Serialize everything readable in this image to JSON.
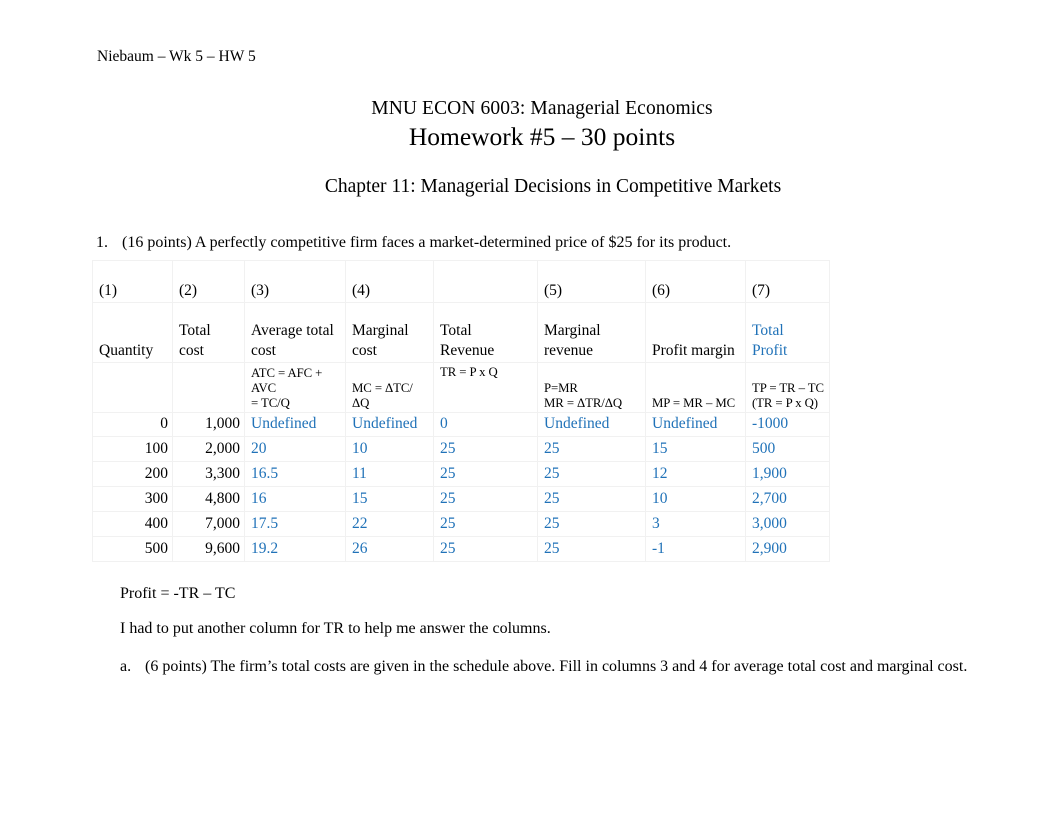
{
  "document": {
    "running_head": "Niebaum – Wk 5 – HW 5",
    "title_line_1": "MNU ECON 6003: Managerial Economics",
    "title_line_2": "Homework #5 – 30 points",
    "chapter_line": "Chapter 11: Managerial Decisions in Competitive Markets",
    "accent_color": "#2072B8"
  },
  "question1": {
    "marker": "1.",
    "text": "(16 points) A perfectly competitive firm faces a market-determined  price of $25 for its product."
  },
  "table": {
    "column_numbers": [
      "(1)",
      "(2)",
      "(3)",
      "(4)",
      "",
      "(5)",
      "(6)",
      "(7)"
    ],
    "column_labels": [
      "Quantity",
      "Total cost",
      "Average total cost",
      "Marginal cost",
      "Total Revenue",
      "Marginal revenue",
      "Profit margin",
      "Total Profit"
    ],
    "column_formulas": [
      "",
      "",
      "ATC = AFC + AVC = TC/Q",
      "MC = ΔTC/ΔQ",
      "TR = P x Q",
      "P=MR MR = ΔTR/ΔQ",
      "MP = MR – MC",
      "TP = TR – TC (TR = P x Q)"
    ],
    "formula_cells": {
      "atc_line1": "ATC = AFC + AVC",
      "atc_line2": "= TC/Q",
      "mc": "MC = ΔTC/ΔQ",
      "tr": "TR = P x Q",
      "mr_line1": "P=MR",
      "mr_line2": "MR = ΔTR/ΔQ",
      "mp": "MP = MR – MC",
      "tp_line1": "TP = TR – TC",
      "tp_line2": "(TR = P x Q)"
    },
    "label_cells": {
      "quantity": "Quantity",
      "total_cost_l1": "Total",
      "total_cost_l2": "cost",
      "atc_l1": "Average total",
      "atc_l2": "cost",
      "mc_l1": "Marginal",
      "mc_l2": "cost",
      "tr_l1": "Total",
      "tr_l2": "Revenue",
      "mr_l1": "Marginal",
      "mr_l2": "revenue",
      "mp": "Profit margin",
      "tp_l1": "Total",
      "tp_l2": "Profit"
    },
    "rows": [
      {
        "quantity": "0",
        "total_cost": "1,000",
        "atc": "Undefined",
        "mc": "Undefined",
        "tr": "0",
        "mr": "Undefined",
        "mp": "Undefined",
        "tp": "-1000"
      },
      {
        "quantity": "100",
        "total_cost": "2,000",
        "atc": "20",
        "mc": "10",
        "tr": "25",
        "mr": "25",
        "mp": "15",
        "tp": "500"
      },
      {
        "quantity": "200",
        "total_cost": "3,300",
        "atc": "16.5",
        "mc": "11",
        "tr": "25",
        "mr": "25",
        "mp": "12",
        "tp": "1,900"
      },
      {
        "quantity": "300",
        "total_cost": "4,800",
        "atc": "16",
        "mc": "15",
        "tr": "25",
        "mr": "25",
        "mp": "10",
        "tp": "2,700"
      },
      {
        "quantity": "400",
        "total_cost": "7,000",
        "atc": "17.5",
        "mc": "22",
        "tr": "25",
        "mr": "25",
        "mp": "3",
        "tp": "3,000"
      },
      {
        "quantity": "500",
        "total_cost": "9,600",
        "atc": "19.2",
        "mc": "26",
        "tr": "25",
        "mr": "25",
        "mp": "-1",
        "tp": "2,900"
      }
    ]
  },
  "notes": {
    "profit_formula": "Profit = -TR – TC",
    "comment": "I had to put another column for TR to help me answer the columns."
  },
  "question1a": {
    "marker": "a.",
    "text": "(6 points) The firm’s total costs are given in the schedule above.   Fill in columns 3 and 4 for average total cost and marginal cost."
  }
}
